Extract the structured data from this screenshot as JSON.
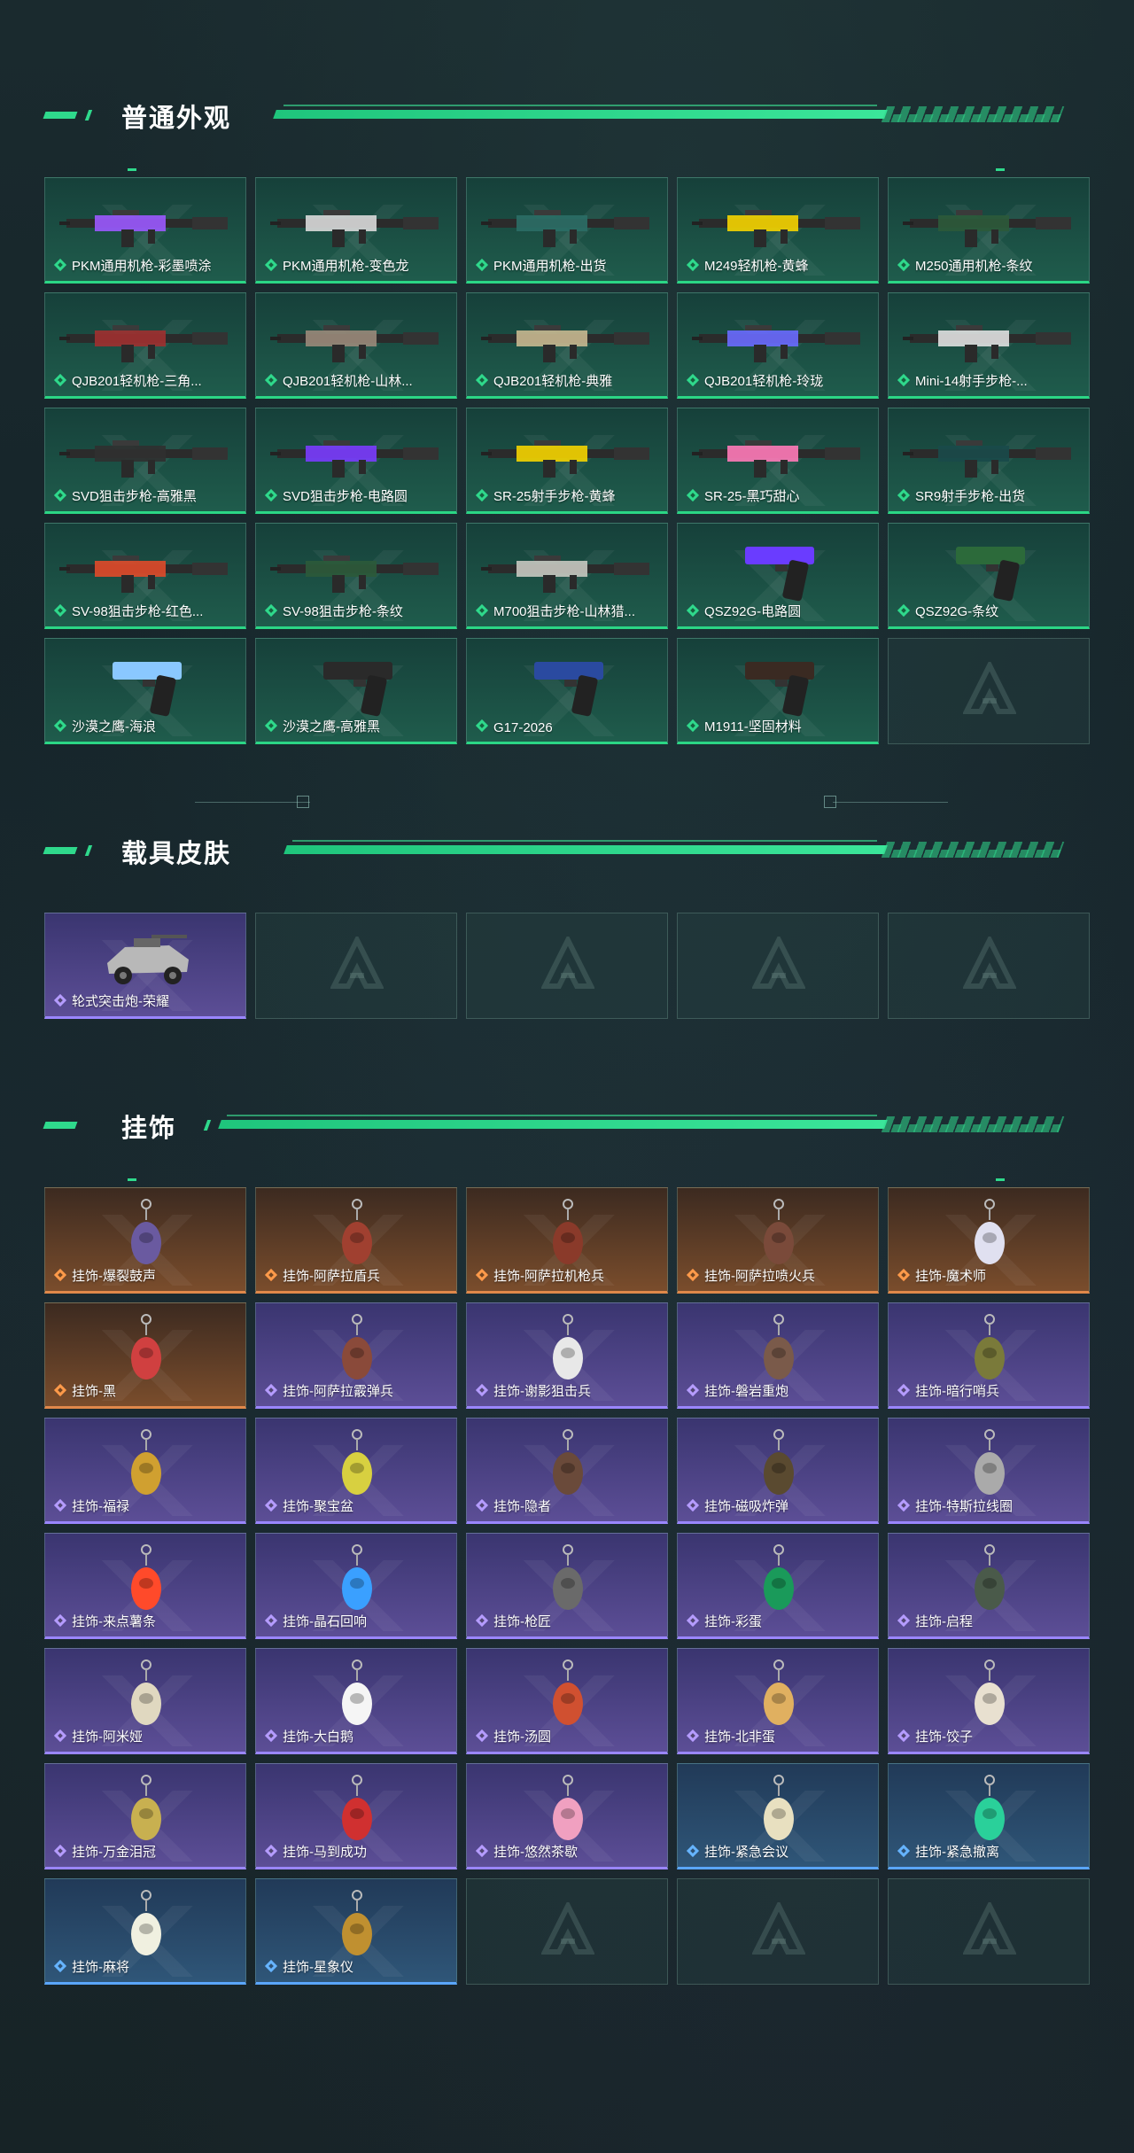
{
  "sections": {
    "appearance": {
      "title": "普通外观",
      "items": [
        {
          "label": "PKM通用机枪-彩墨喷涂",
          "color": "#9b59ff"
        },
        {
          "label": "PKM通用机枪-变色龙",
          "color": "#d9d9d9"
        },
        {
          "label": "PKM通用机枪-出货",
          "color": "#2b6e66"
        },
        {
          "label": "M249轻机枪-黄蜂",
          "color": "#f5d400"
        },
        {
          "label": "M250通用机枪-条纹",
          "color": "#2c5a3a"
        },
        {
          "label": "QJB201轻机枪-三角...",
          "color": "#a03030"
        },
        {
          "label": "QJB201轻机枪-山林...",
          "color": "#9a8a7a"
        },
        {
          "label": "QJB201轻机枪-典雅",
          "color": "#c8b890"
        },
        {
          "label": "QJB201轻机枪-玲珑",
          "color": "#6a6aff"
        },
        {
          "label": "Mini-14射手步枪-...",
          "color": "#e0e0e0"
        },
        {
          "label": "SVD狙击步枪-高雅黑",
          "color": "#303030"
        },
        {
          "label": "SVD狙击步枪-电路圆",
          "color": "#7a3cff"
        },
        {
          "label": "SR-25射手步枪-黄蜂",
          "color": "#f5d400"
        },
        {
          "label": "SR-25-黑巧甜心",
          "color": "#ff7ab8"
        },
        {
          "label": "SR9射手步枪-出货",
          "color": "#1a4a4a"
        },
        {
          "label": "SV-98狙击步枪-红色...",
          "color": "#e04a2a"
        },
        {
          "label": "SV-98狙击步枪-条纹",
          "color": "#2c5a3a"
        },
        {
          "label": "M700狙击步枪-山林猎...",
          "color": "#c8c8c0"
        },
        {
          "label": "QSZ92G-电路圆",
          "color": "#6a3cff"
        },
        {
          "label": "QSZ92G-条纹",
          "color": "#2c6a3a"
        },
        {
          "label": "沙漠之鹰-海浪",
          "color": "#8ac8ff"
        },
        {
          "label": "沙漠之鹰-高雅黑",
          "color": "#2a2a2a"
        },
        {
          "label": "G17-2026",
          "color": "#2a4aa0"
        },
        {
          "label": "M1911-坚固材料",
          "color": "#3a2a22"
        }
      ]
    },
    "vehicle": {
      "title": "载具皮肤",
      "items": [
        {
          "label": "轮式突击炮-荣耀",
          "color": "#bbbbbb"
        }
      ]
    },
    "charms": {
      "title": "挂饰",
      "items": [
        {
          "label": "挂饰-爆裂鼓声",
          "rarity": "orange",
          "color": "#6a5aa0"
        },
        {
          "label": "挂饰-阿萨拉盾兵",
          "rarity": "orange",
          "color": "#a04030"
        },
        {
          "label": "挂饰-阿萨拉机枪兵",
          "rarity": "orange",
          "color": "#8a3a2a"
        },
        {
          "label": "挂饰-阿萨拉喷火兵",
          "rarity": "orange",
          "color": "#7a4a3a"
        },
        {
          "label": "挂饰-魔术师",
          "rarity": "orange",
          "color": "#e0e0f0"
        },
        {
          "label": "挂饰-黑",
          "rarity": "orange",
          "color": "#d04040"
        },
        {
          "label": "挂饰-阿萨拉霰弹兵",
          "rarity": "purple",
          "color": "#8a4a3a"
        },
        {
          "label": "挂饰-谢影狙击兵",
          "rarity": "purple",
          "color": "#e8e8e8"
        },
        {
          "label": "挂饰-磐岩重炮",
          "rarity": "purple",
          "color": "#7a5a4a"
        },
        {
          "label": "挂饰-暗行哨兵",
          "rarity": "purple",
          "color": "#7a7a3a"
        },
        {
          "label": "挂饰-福禄",
          "rarity": "purple",
          "color": "#d0a030"
        },
        {
          "label": "挂饰-聚宝盆",
          "rarity": "purple",
          "color": "#d8d040"
        },
        {
          "label": "挂饰-隐者",
          "rarity": "purple",
          "color": "#6a4a3a"
        },
        {
          "label": "挂饰-磁吸炸弹",
          "rarity": "purple",
          "color": "#5a4a30"
        },
        {
          "label": "挂饰-特斯拉线圈",
          "rarity": "purple",
          "color": "#aaaaaa"
        },
        {
          "label": "挂饰-来点薯条",
          "rarity": "purple",
          "color": "#ff4a2a"
        },
        {
          "label": "挂饰-晶石回响",
          "rarity": "purple",
          "color": "#3aa0ff"
        },
        {
          "label": "挂饰-枪匠",
          "rarity": "purple",
          "color": "#6a6a6a"
        },
        {
          "label": "挂饰-彩蛋",
          "rarity": "purple",
          "color": "#1a9a5a"
        },
        {
          "label": "挂饰-启程",
          "rarity": "purple",
          "color": "#4a5a4a"
        },
        {
          "label": "挂饰-阿米娅",
          "rarity": "purple",
          "color": "#e0d8c0"
        },
        {
          "label": "挂饰-大白鹅",
          "rarity": "purple",
          "color": "#f5f5f5"
        },
        {
          "label": "挂饰-汤圆",
          "rarity": "purple",
          "color": "#d05030"
        },
        {
          "label": "挂饰-北非蛋",
          "rarity": "purple",
          "color": "#e0b060"
        },
        {
          "label": "挂饰-饺子",
          "rarity": "purple",
          "color": "#e8e0d0"
        },
        {
          "label": "挂饰-万金泪冠",
          "rarity": "purple",
          "color": "#c8b050"
        },
        {
          "label": "挂饰-马到成功",
          "rarity": "purple",
          "color": "#d03030"
        },
        {
          "label": "挂饰-悠然茶歇",
          "rarity": "purple",
          "color": "#f0a0c0"
        },
        {
          "label": "挂饰-紧急会议",
          "rarity": "blue",
          "color": "#e8e0c0"
        },
        {
          "label": "挂饰-紧急撤离",
          "rarity": "blue",
          "color": "#2ad09a"
        },
        {
          "label": "挂饰-麻将",
          "rarity": "blue",
          "color": "#f0f0e0"
        },
        {
          "label": "挂饰-星象仪",
          "rarity": "blue",
          "color": "#c09030"
        }
      ]
    }
  }
}
